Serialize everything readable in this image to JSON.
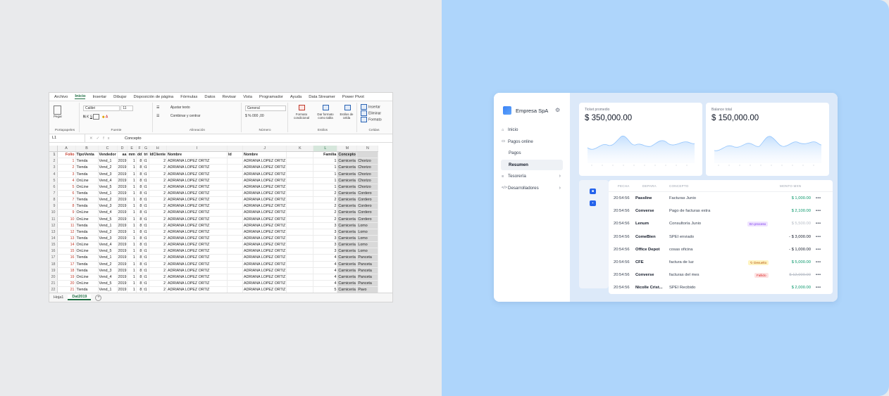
{
  "excel": {
    "menu_tabs": [
      "Archivo",
      "Inicio",
      "Insertar",
      "Dibujar",
      "Disposición de página",
      "Fórmulas",
      "Datos",
      "Revisar",
      "Vista",
      "Programador",
      "Ayuda",
      "Data Streamer",
      "Power Pivot"
    ],
    "groups": {
      "portapapeles": "Portapapeles",
      "pegar": "Pegar",
      "fuente": "Fuente",
      "alineacion": "Alineación",
      "numero": "Número",
      "estilos": "Estilos",
      "celdas": "Celdas"
    },
    "font_name": "Calibri",
    "font_size": "11",
    "ajustar_texto": "Ajustar texto",
    "combinar": "Combinar y centrar",
    "number_format": "General",
    "formato_condicional": "Formato condicional",
    "dar_formato": "Dar formato como tabla",
    "estilos_celda": "Estilos de celda",
    "insertar": "Insertar",
    "eliminar": "Eliminar",
    "formato": "Formato",
    "name_box": "L1",
    "formula_value": "Concepto",
    "col_letters": [
      "A",
      "B",
      "C",
      "D",
      "E",
      "F",
      "G",
      "H",
      "I",
      "J",
      "K",
      "L",
      "M",
      "N",
      "O"
    ],
    "header_row": [
      "Folio",
      "TipoVenta",
      "Vendedor",
      "aa",
      "mm",
      "dd",
      "tri",
      "IdCliente",
      "Nombre",
      "Id",
      "Nombre",
      "",
      "Familia",
      "Concepto",
      ""
    ],
    "rows": [
      [
        "1",
        "Tienda",
        "Vend_1",
        "2019",
        "1",
        "8",
        "t1",
        "2",
        "ADRIANA LOPEZ ORTIZ",
        "",
        "ADRIANA LOPEZ ORTIZ",
        "",
        "1",
        "Carnicería",
        "Chorizo"
      ],
      [
        "2",
        "Tienda",
        "Vend_2",
        "2019",
        "1",
        "8",
        "t1",
        "2",
        "ADRIANA LOPEZ ORTIZ",
        "",
        "ADRIANA LOPEZ ORTIZ",
        "",
        "1",
        "Carnicería",
        "Chorizo"
      ],
      [
        "3",
        "Tienda",
        "Vend_3",
        "2019",
        "1",
        "8",
        "t1",
        "2",
        "ADRIANA LOPEZ ORTIZ",
        "",
        "ADRIANA LOPEZ ORTIZ",
        "",
        "1",
        "Carnicería",
        "Chorizo"
      ],
      [
        "4",
        "OnLine",
        "Vend_4",
        "2019",
        "1",
        "8",
        "t1",
        "2",
        "ADRIANA LOPEZ ORTIZ",
        "",
        "ADRIANA LOPEZ ORTIZ",
        "",
        "1",
        "Carnicería",
        "Chorizo"
      ],
      [
        "5",
        "OnLine",
        "Vend_5",
        "2019",
        "1",
        "8",
        "t1",
        "2",
        "ADRIANA LOPEZ ORTIZ",
        "",
        "ADRIANA LOPEZ ORTIZ",
        "",
        "1",
        "Carnicería",
        "Chorizo"
      ],
      [
        "6",
        "Tienda",
        "Vend_1",
        "2019",
        "1",
        "8",
        "t1",
        "2",
        "ADRIANA LOPEZ ORTIZ",
        "",
        "ADRIANA LOPEZ ORTIZ",
        "",
        "2",
        "Carnicería",
        "Cordero"
      ],
      [
        "7",
        "Tienda",
        "Vend_2",
        "2019",
        "1",
        "8",
        "t1",
        "2",
        "ADRIANA LOPEZ ORTIZ",
        "",
        "ADRIANA LOPEZ ORTIZ",
        "",
        "2",
        "Carnicería",
        "Cordero"
      ],
      [
        "8",
        "Tienda",
        "Vend_3",
        "2019",
        "1",
        "8",
        "t1",
        "2",
        "ADRIANA LOPEZ ORTIZ",
        "",
        "ADRIANA LOPEZ ORTIZ",
        "",
        "2",
        "Carnicería",
        "Cordero"
      ],
      [
        "9",
        "OnLine",
        "Vend_4",
        "2019",
        "1",
        "8",
        "t1",
        "2",
        "ADRIANA LOPEZ ORTIZ",
        "",
        "ADRIANA LOPEZ ORTIZ",
        "",
        "2",
        "Carnicería",
        "Cordero"
      ],
      [
        "10",
        "OnLine",
        "Vend_5",
        "2019",
        "1",
        "8",
        "t1",
        "2",
        "ADRIANA LOPEZ ORTIZ",
        "",
        "ADRIANA LOPEZ ORTIZ",
        "",
        "2",
        "Carnicería",
        "Cordero"
      ],
      [
        "11",
        "Tienda",
        "Vend_1",
        "2019",
        "1",
        "8",
        "t1",
        "2",
        "ADRIANA LOPEZ ORTIZ",
        "",
        "ADRIANA LOPEZ ORTIZ",
        "",
        "3",
        "Carnicería",
        "Lomo"
      ],
      [
        "12",
        "Tienda",
        "Vend_2",
        "2019",
        "1",
        "8",
        "t1",
        "2",
        "ADRIANA LOPEZ ORTIZ",
        "",
        "ADRIANA LOPEZ ORTIZ",
        "",
        "3",
        "Carnicería",
        "Lomo"
      ],
      [
        "13",
        "Tienda",
        "Vend_3",
        "2019",
        "1",
        "8",
        "t1",
        "2",
        "ADRIANA LOPEZ ORTIZ",
        "",
        "ADRIANA LOPEZ ORTIZ",
        "",
        "3",
        "Carnicería",
        "Lomo"
      ],
      [
        "14",
        "OnLine",
        "Vend_4",
        "2019",
        "1",
        "8",
        "t1",
        "2",
        "ADRIANA LOPEZ ORTIZ",
        "",
        "ADRIANA LOPEZ ORTIZ",
        "",
        "3",
        "Carnicería",
        "Lomo"
      ],
      [
        "15",
        "OnLine",
        "Vend_5",
        "2019",
        "1",
        "8",
        "t1",
        "2",
        "ADRIANA LOPEZ ORTIZ",
        "",
        "ADRIANA LOPEZ ORTIZ",
        "",
        "3",
        "Carnicería",
        "Lomo"
      ],
      [
        "16",
        "Tienda",
        "Vend_1",
        "2019",
        "1",
        "8",
        "t1",
        "2",
        "ADRIANA LOPEZ ORTIZ",
        "",
        "ADRIANA LOPEZ ORTIZ",
        "",
        "4",
        "Carnicería",
        "Panceta"
      ],
      [
        "17",
        "Tienda",
        "Vend_2",
        "2019",
        "1",
        "8",
        "t1",
        "2",
        "ADRIANA LOPEZ ORTIZ",
        "",
        "ADRIANA LOPEZ ORTIZ",
        "",
        "4",
        "Carnicería",
        "Panceta"
      ],
      [
        "18",
        "Tienda",
        "Vend_3",
        "2019",
        "1",
        "8",
        "t1",
        "2",
        "ADRIANA LOPEZ ORTIZ",
        "",
        "ADRIANA LOPEZ ORTIZ",
        "",
        "4",
        "Carnicería",
        "Panceta"
      ],
      [
        "19",
        "OnLine",
        "Vend_4",
        "2019",
        "1",
        "8",
        "t1",
        "2",
        "ADRIANA LOPEZ ORTIZ",
        "",
        "ADRIANA LOPEZ ORTIZ",
        "",
        "4",
        "Carnicería",
        "Panceta"
      ],
      [
        "20",
        "OnLine",
        "Vend_5",
        "2019",
        "1",
        "8",
        "t1",
        "2",
        "ADRIANA LOPEZ ORTIZ",
        "",
        "ADRIANA LOPEZ ORTIZ",
        "",
        "4",
        "Carnicería",
        "Panceta"
      ],
      [
        "21",
        "Tienda",
        "Vend_1",
        "2019",
        "1",
        "8",
        "t1",
        "2",
        "ADRIANA LOPEZ ORTIZ",
        "",
        "ADRIANA LOPEZ ORTIZ",
        "",
        "5",
        "Carnicería",
        "Pavo"
      ],
      [
        "22",
        "Tienda",
        "Vend_2",
        "2019",
        "1",
        "8",
        "t1",
        "2",
        "ADRIANA LOPEZ ORTIZ",
        "",
        "ADRIANA LOPEZ ORTIZ",
        "",
        "5",
        "Carnicería",
        "Pavo"
      ]
    ],
    "sheets": [
      "Hoja1",
      "Dat2019"
    ]
  },
  "dashboard": {
    "company": "Empresa SpA",
    "nav": [
      {
        "label": "Inicio",
        "icon": "home-icon",
        "glyph": "⌂",
        "sub": false,
        "chevron": false
      },
      {
        "label": "Pagos online",
        "icon": "card-icon",
        "glyph": "▭",
        "sub": false,
        "chevron": false
      },
      {
        "label": "Pagos",
        "icon": "",
        "glyph": "",
        "sub": true,
        "chevron": false
      },
      {
        "label": "Resumen",
        "icon": "",
        "glyph": "",
        "sub": true,
        "chevron": false,
        "active": true
      },
      {
        "label": "Tesorería",
        "icon": "treasury-icon",
        "glyph": "≡",
        "sub": false,
        "chevron": true
      },
      {
        "label": "Desarrolladores",
        "icon": "code-icon",
        "glyph": "</>",
        "sub": false,
        "chevron": true
      }
    ],
    "cards": [
      {
        "title": "Ticket promedio",
        "value": "$ 350,000.00"
      },
      {
        "title": "Balance total",
        "value": "$ 150,000.00"
      }
    ],
    "table_headers": {
      "fecha": "FECHA",
      "destino": "DEPARA",
      "concepto": "CONCEPTO",
      "monto": "MONTO MXN"
    },
    "transactions": [
      {
        "time": "20:54:56",
        "dest": "Passline",
        "concept": "Facturas Junio",
        "badge": "",
        "badge_type": "",
        "amount": "$ 1,000.00",
        "amount_style": "green"
      },
      {
        "time": "20:54:56",
        "dest": "Converse",
        "concept": "Pago de facturas extra",
        "badge": "",
        "badge_type": "",
        "amount": "$ 2,100.00",
        "amount_style": "green"
      },
      {
        "time": "20:54:56",
        "dest": "Lenum",
        "concept": "Consultoría Junio",
        "badge": "En proceso",
        "badge_type": "proc",
        "amount": "$ 5,500.00",
        "amount_style": "gray"
      },
      {
        "time": "20:54:56",
        "dest": "ComeBien",
        "concept": "SPEI enviado",
        "badge": "",
        "badge_type": "",
        "amount": "- $ 3,000.00",
        "amount_style": "dark"
      },
      {
        "time": "20:54:56",
        "dest": "Office Depot",
        "concept": "cosas oficina",
        "badge": "",
        "badge_type": "",
        "amount": "- $ 1,000.00",
        "amount_style": "dark"
      },
      {
        "time": "20:54:56",
        "dest": "CFE",
        "concept": "factura de luz",
        "badge": "↻ Devuelto",
        "badge_type": "dev",
        "amount": "$ 5,000.00",
        "amount_style": "green"
      },
      {
        "time": "20:54:56",
        "dest": "Converse",
        "concept": "facturas del mes",
        "badge": "Fallido",
        "badge_type": "fail",
        "amount": "$ 12,000.00",
        "amount_style": "strike"
      },
      {
        "time": "20:54:56",
        "dest": "Nicolle Crist...",
        "concept": "SPEI Recibido",
        "badge": "",
        "badge_type": "",
        "amount": "$ 2,000.00",
        "amount_style": "green"
      }
    ],
    "more_label": "•••",
    "colors": {
      "accent": "#2563eb",
      "bg": "#aed5fb",
      "green": "#059669"
    }
  }
}
